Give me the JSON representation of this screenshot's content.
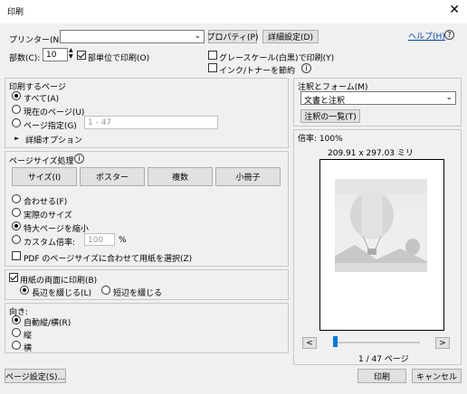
{
  "window": {
    "title": "印刷",
    "close_glyph": "✕"
  },
  "header": {
    "printer_label": "プリンター(N):",
    "printer_value": "",
    "properties_button": "プロパティ(P)",
    "advanced_button": "詳細設定(D)",
    "help_link": "ヘルプ(H)",
    "help_icon_glyph": "?",
    "copies_label": "部数(C):",
    "copies_value": "10",
    "collate_label": "部単位で印刷(O)",
    "collate_checked": true,
    "grayscale_label": "グレースケール(白黒)で印刷(Y)",
    "grayscale_checked": false,
    "save_ink_label": "インク/トナーを節約",
    "save_ink_checked": false,
    "info_glyph": "i"
  },
  "pages_to_print": {
    "title": "印刷するページ",
    "options": [
      {
        "label": "すべて(A)",
        "checked": true
      },
      {
        "label": "現在のページ(U)",
        "checked": false
      },
      {
        "label": "ページ指定(G)",
        "checked": false
      }
    ],
    "range_placeholder": "1 - 47",
    "more_options": "詳細オプション",
    "more_options_glyph": "►"
  },
  "page_sizing": {
    "title": "ページサイズ処理",
    "info_glyph": "i",
    "buttons": [
      "サイズ(I)",
      "ポスター",
      "複数",
      "小冊子"
    ],
    "options": [
      {
        "label": "合わせる(F)",
        "checked": false
      },
      {
        "label": "実際のサイズ",
        "checked": false
      },
      {
        "label": "特大ページを縮小",
        "checked": true
      },
      {
        "label": "カスタム倍率:",
        "checked": false
      }
    ],
    "custom_scale_value": "100",
    "percent": "%",
    "pdf_paper_label": "PDF のページサイズに合わせて用紙を選択(Z)",
    "pdf_paper_checked": false
  },
  "duplex": {
    "label": "用紙の両面に印刷(B)",
    "checked": true,
    "options": [
      {
        "label": "長辺を綴じる(L)",
        "checked": true
      },
      {
        "label": "短辺を綴じる",
        "checked": false
      }
    ]
  },
  "orientation": {
    "title": "向き:",
    "options": [
      {
        "label": "自動縦/横(R)",
        "checked": true
      },
      {
        "label": "縦",
        "checked": false
      },
      {
        "label": "横",
        "checked": false
      }
    ]
  },
  "comments": {
    "title": "注釈とフォーム(M)",
    "select_value": "文書と注釈",
    "summary_button": "注釈の一覧(T)"
  },
  "preview": {
    "scale_label": "倍率: 100%",
    "dimensions": "209.91 x 297.03 ミリ",
    "prev_glyph": "<",
    "next_glyph": ">",
    "page_indicator": "1 / 47 ページ",
    "slider_position": 0.0
  },
  "footer": {
    "page_setup_button": "ページ設定(S)...",
    "print_button": "印刷",
    "cancel_button": "キャンセル"
  }
}
